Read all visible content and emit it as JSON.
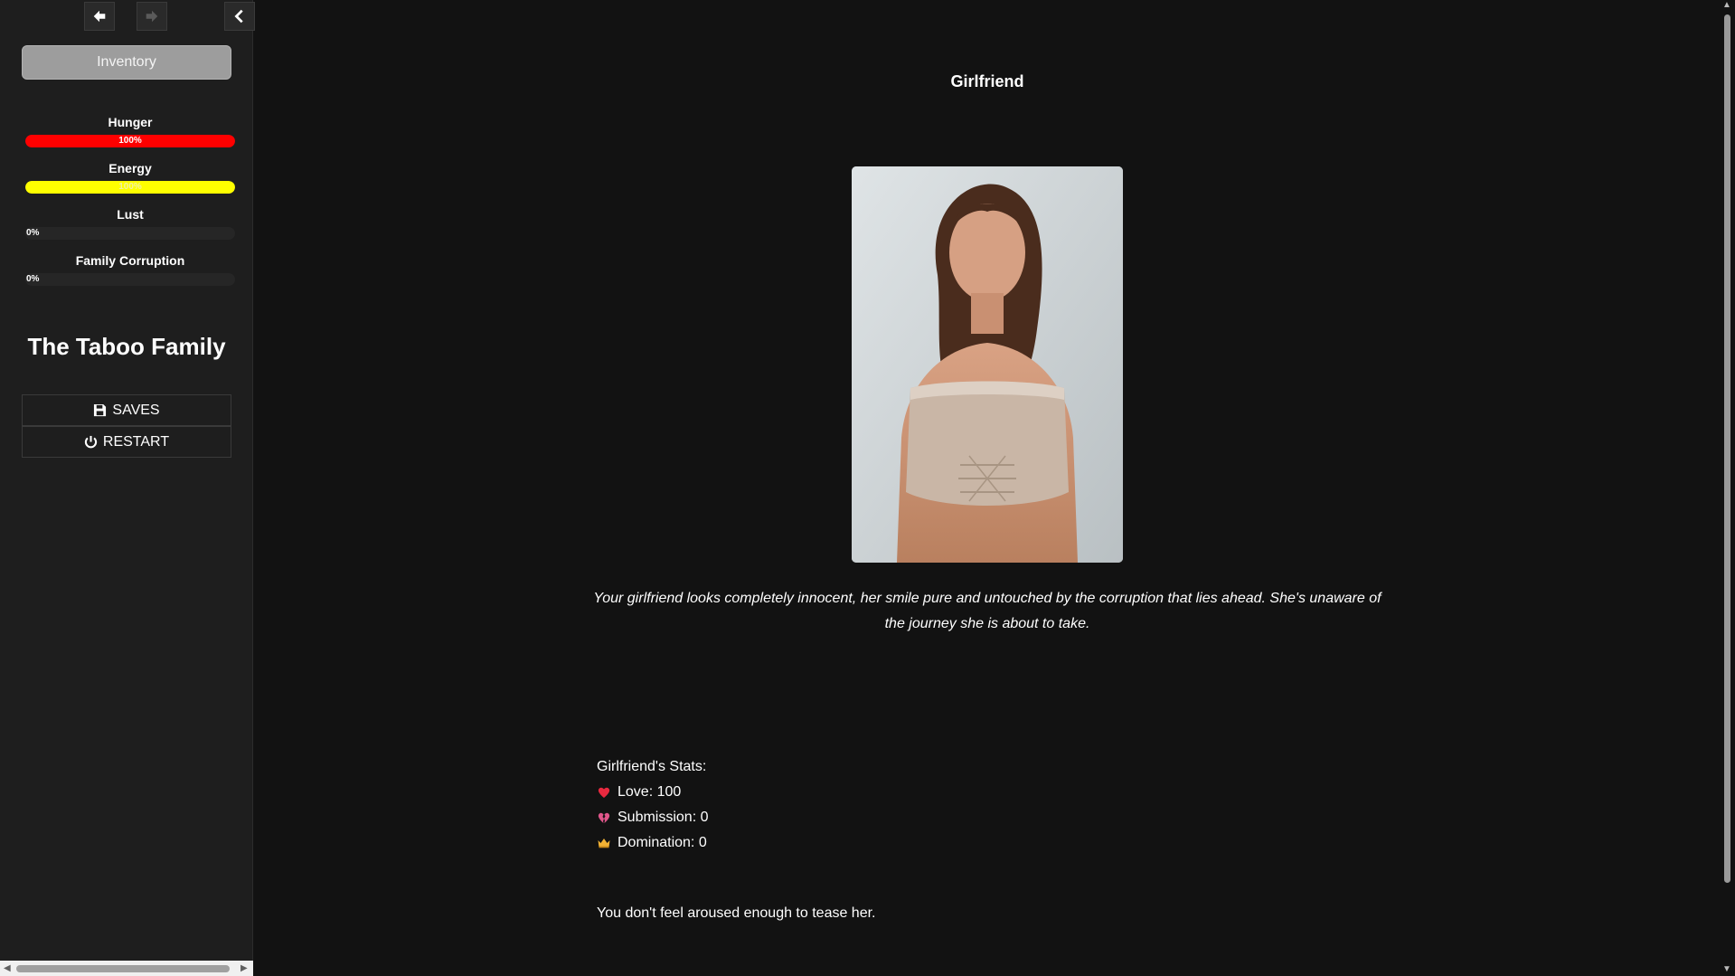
{
  "sidebar": {
    "inventory_label": "Inventory",
    "stats": [
      {
        "label": "Hunger",
        "value_text": "100%",
        "fraction": 1.0,
        "color": "#ff0000"
      },
      {
        "label": "Energy",
        "value_text": "100%",
        "fraction": 1.0,
        "color": "#ffff00"
      },
      {
        "label": "Lust",
        "value_text": "0%",
        "fraction": 0.0,
        "color": "#ff0000"
      },
      {
        "label": "Family Corruption",
        "value_text": "0%",
        "fraction": 0.0,
        "color": "#ff0000"
      }
    ],
    "game_title": "The Taboo Family",
    "saves_label": "SAVES",
    "restart_label": "RESTART"
  },
  "main": {
    "heading": "Girlfriend",
    "description": "Your girlfriend looks completely innocent, her smile pure and untouched by the corruption that lies ahead. She's unaware of the journey she is about to take.",
    "stats_heading": "Girlfriend's Stats:",
    "stats": [
      {
        "icon": "heart-icon",
        "text": "Love: 100"
      },
      {
        "icon": "broken-heart-icon",
        "text": "Submission: 0"
      },
      {
        "icon": "crown-icon",
        "text": "Domination: 0"
      }
    ],
    "arousal_message": "You don't feel aroused enough to tease her."
  },
  "colors": {
    "background": "#121212",
    "sidebar": "#1e1e1e",
    "hunger": "#ff0000",
    "energy": "#ffff00"
  }
}
